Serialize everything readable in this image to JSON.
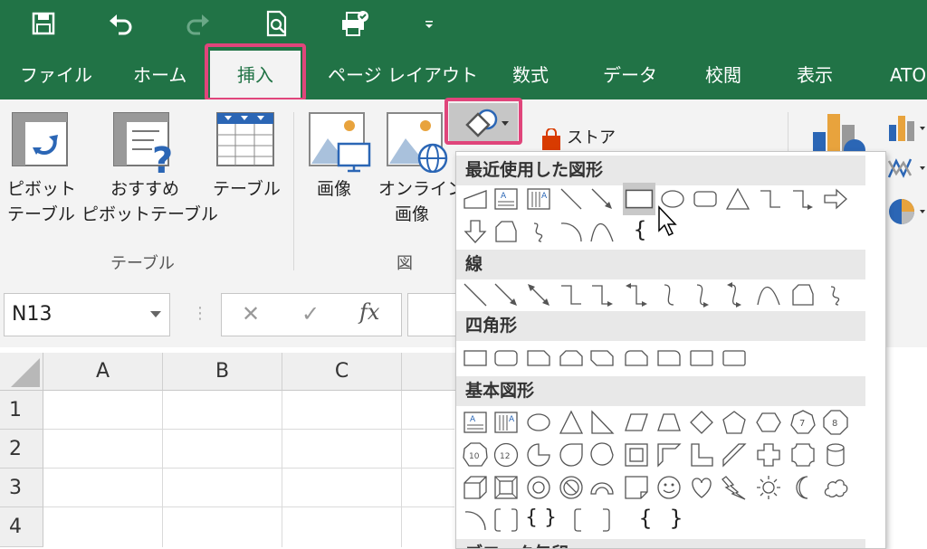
{
  "quick_access": {
    "icons": [
      "save-icon",
      "undo-icon",
      "redo-icon",
      "print-preview-icon",
      "print-icon",
      "customize-qat-icon"
    ]
  },
  "tabs": [
    "ファイル",
    "ホーム",
    "挿入",
    "ページ レイアウト",
    "数式",
    "データ",
    "校閲",
    "表示",
    "ATO"
  ],
  "ribbon": {
    "pivot_label_1": "ピボット",
    "pivot_label_2": "テーブル",
    "rec_pivot_label_1": "おすすめ",
    "rec_pivot_label_2": "ピボットテーブル",
    "table_label": "テーブル",
    "group_table": "テーブル",
    "image_label": "画像",
    "online_image_label_1": "オンライン",
    "online_image_label_2": "画像",
    "group_figure": "図",
    "store_label": "ストア"
  },
  "formula_bar": {
    "name_box": "N13",
    "cancel": "✕",
    "enter": "✓",
    "fx": "fx"
  },
  "grid": {
    "columns": [
      "A",
      "B",
      "C"
    ],
    "rows": [
      "1",
      "2",
      "3",
      "4"
    ]
  },
  "shapes_menu": {
    "categories": [
      "最近使用した図形",
      "線",
      "四角形",
      "基本図形",
      "ブロック矢印"
    ],
    "recent_bracket": "{",
    "basic_octagon_8": "8",
    "basic_heptagon_7": "7",
    "basic_decagon_10": "10",
    "basic_dodecagon_12": "12",
    "basic_bracket_open": "{",
    "basic_bracket_close": "}",
    "basic_braces": "{ }",
    "textbox_letter": "A"
  },
  "colors": {
    "excel_green": "#217346",
    "highlight_pink": "#e0457b",
    "ribbon_bg": "#f3f3f3"
  }
}
